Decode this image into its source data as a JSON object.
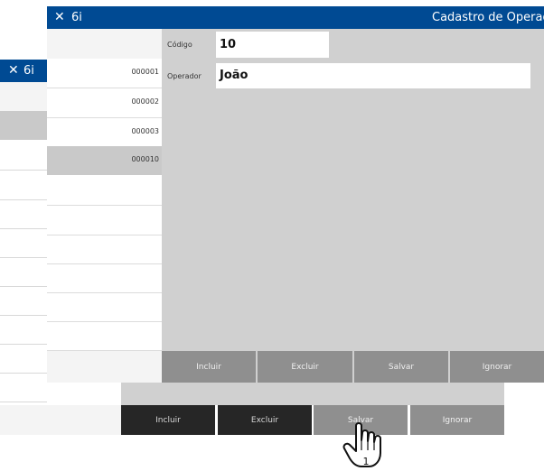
{
  "back_window": {
    "close_glyph": "✕",
    "title_short": "6i",
    "buttons": [
      {
        "label": "Incluir"
      },
      {
        "label": "Excluir"
      },
      {
        "label": "Salvar"
      },
      {
        "label": "Ignorar"
      }
    ]
  },
  "front_window": {
    "close_glyph": "✕",
    "title_short": "6i",
    "title": "Cadastro de Operador",
    "list": {
      "rows": [
        {
          "code": "000001"
        },
        {
          "code": "000002"
        },
        {
          "code": "000003"
        },
        {
          "code": "000010"
        }
      ],
      "selected_index": 3
    },
    "form": {
      "codigo_label": "Código",
      "codigo_value": "10",
      "operador_label": "Operador",
      "operador_value": "João"
    },
    "buttons": [
      {
        "label": "Incluir"
      },
      {
        "label": "Excluir"
      },
      {
        "label": "Salvar"
      },
      {
        "label": "Ignorar"
      }
    ]
  },
  "cursor": {
    "icon": "hand-pointer-icon",
    "badge": "1"
  }
}
